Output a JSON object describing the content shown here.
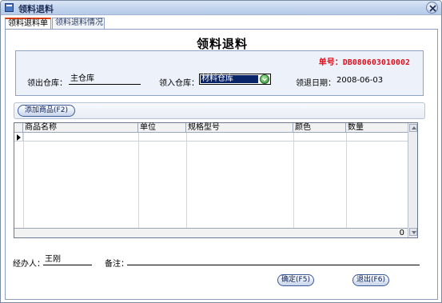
{
  "window": {
    "title": "领料退料"
  },
  "tabs": [
    {
      "label": "领料退料单",
      "active": true
    },
    {
      "label": "领料退料情况",
      "active": false
    }
  ],
  "form": {
    "title": "领料退料",
    "order_no_label": "单号：",
    "order_no_value": "DB080603010002",
    "out_warehouse_label": "领出仓库：",
    "out_warehouse_value": "主仓库",
    "in_warehouse_label": "领入仓库：",
    "in_warehouse_value": "材料仓库",
    "date_label": "领退日期：",
    "date_value": "2008-06-03"
  },
  "toolbar": {
    "add_product_label": "添加商品(F2)"
  },
  "grid": {
    "columns": [
      "商品名称",
      "单位",
      "规格型号",
      "颜色",
      "数量"
    ],
    "rows": [],
    "total_quantity": "0"
  },
  "footer": {
    "handler_label": "经办人：",
    "handler_value": "王刚",
    "remark_label": "备注：",
    "remark_value": "",
    "confirm_label": "确定(F5)",
    "exit_label": "退出(F6)"
  },
  "colors": {
    "order_no": "#e0101c",
    "selection": "#0a246a",
    "info_bg": "#edf2fa"
  }
}
